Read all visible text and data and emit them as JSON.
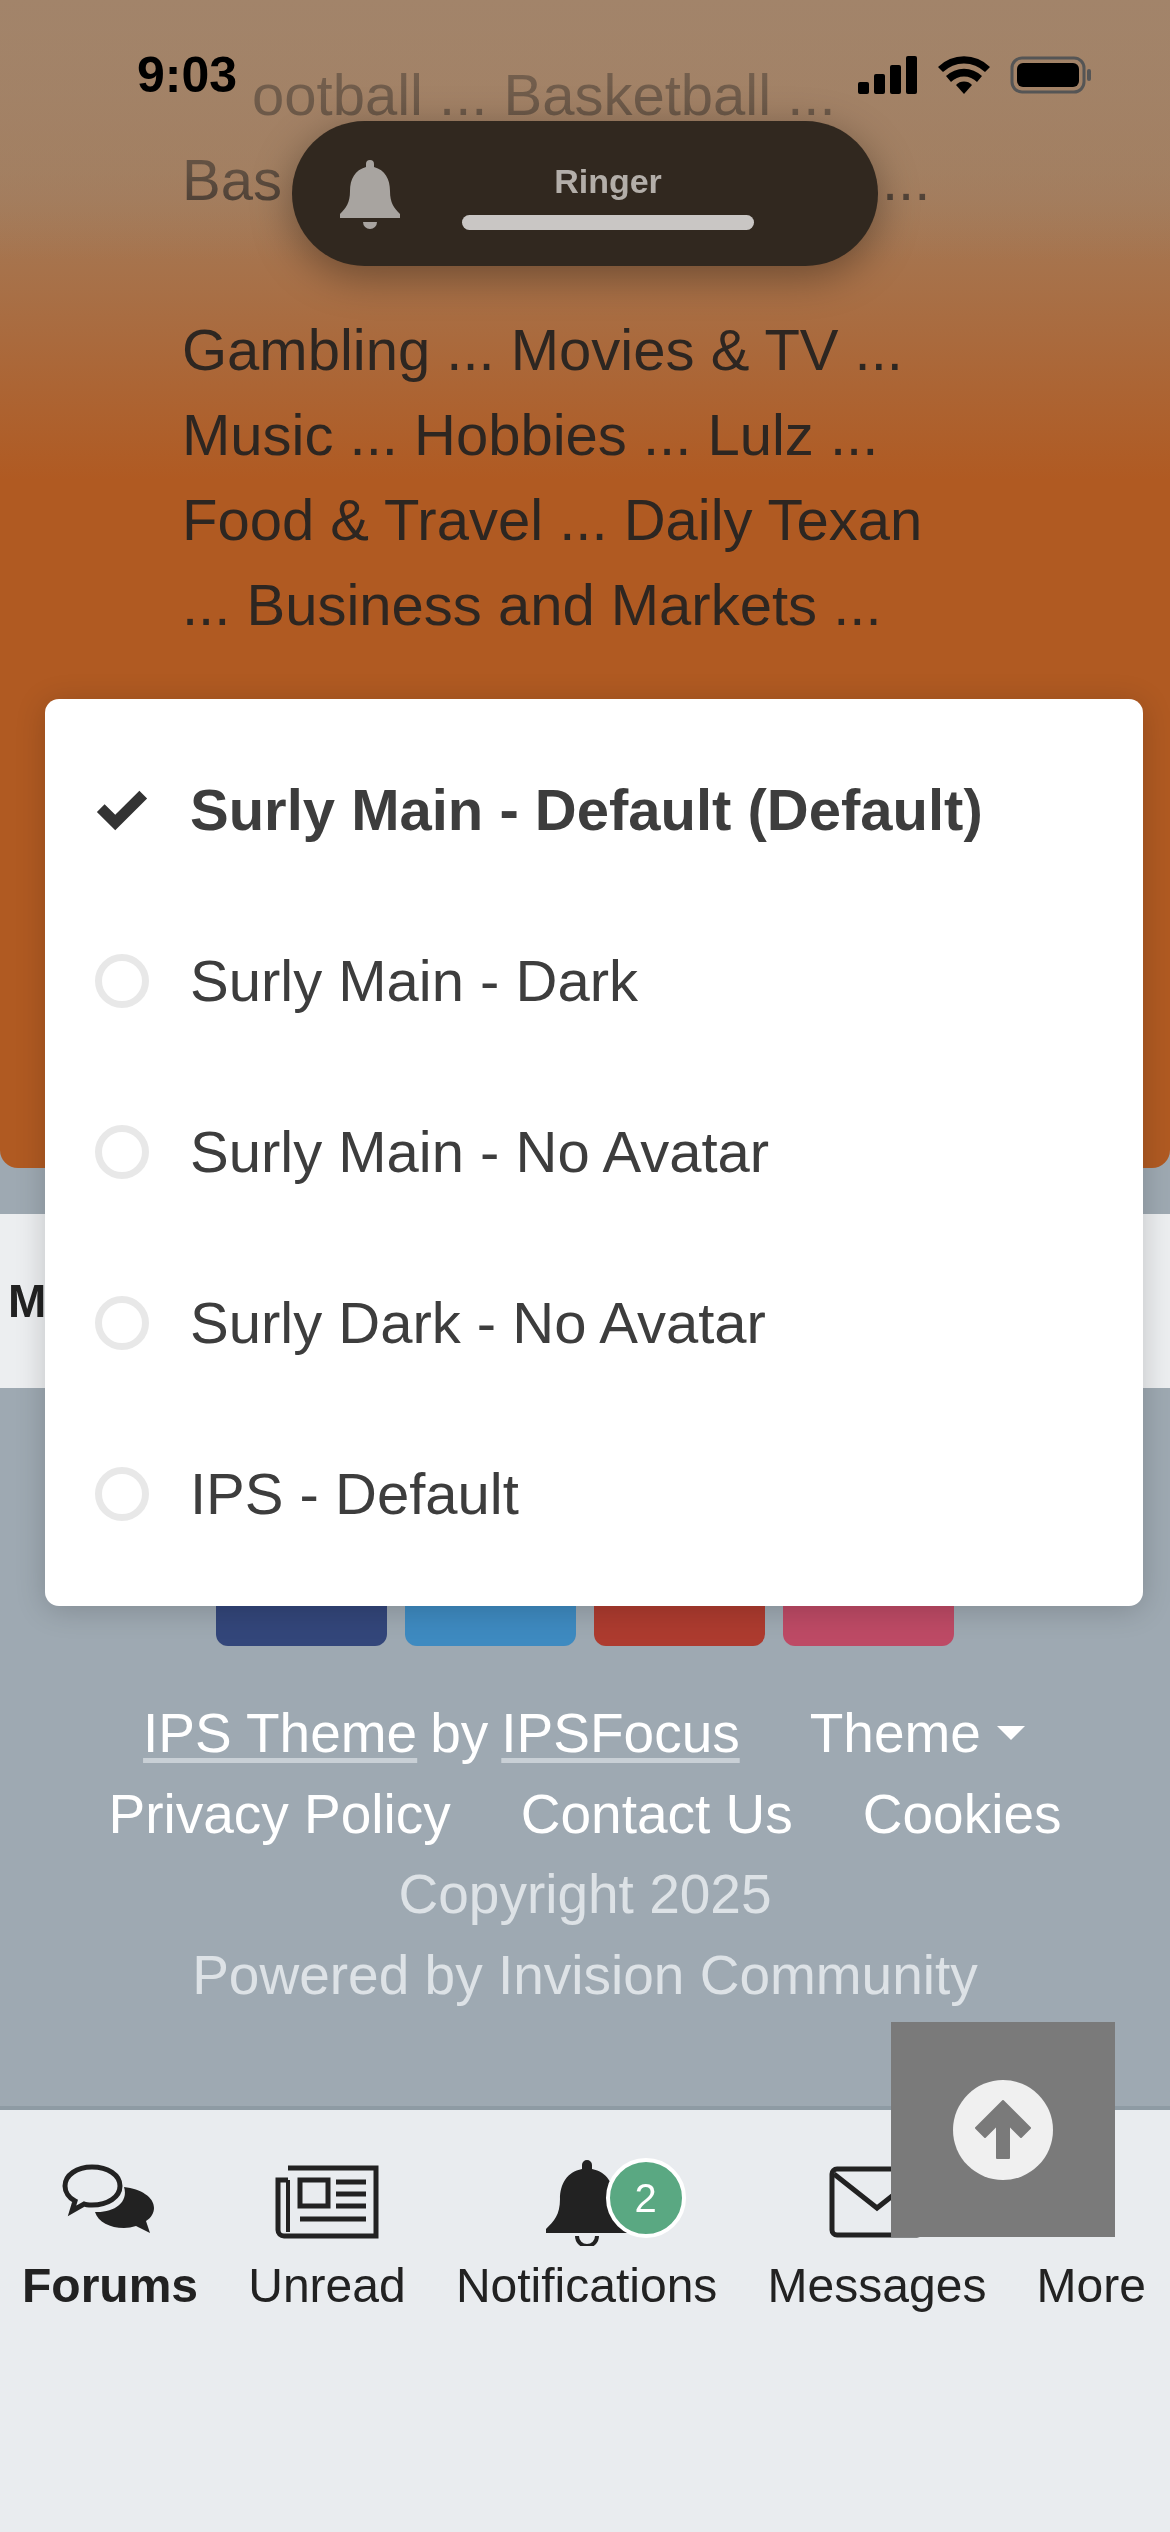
{
  "status_bar": {
    "time": "9:03"
  },
  "ringer": {
    "label": "Ringer",
    "level": 1
  },
  "top_links": [
    {
      "text": "ootball ... Basketball ..."
    },
    {
      "text": "Bas",
      "trailing": "..."
    }
  ],
  "header_links": [
    {
      "text": "Gambling ... Movies & TV ..."
    },
    {
      "text": "Music ... Hobbies ... Lulz ..."
    },
    {
      "text": "Food & Travel ... Daily Texan"
    },
    {
      "text": "... Business and Markets ..."
    }
  ],
  "tab_bar": {
    "label": "M"
  },
  "theme_menu": {
    "items": [
      {
        "label": "Surly Main - Default (Default)",
        "selected": true
      },
      {
        "label": "Surly Main - Dark",
        "selected": false
      },
      {
        "label": "Surly Main - No Avatar",
        "selected": false
      },
      {
        "label": "Surly Dark - No Avatar",
        "selected": false
      },
      {
        "label": "IPS - Default",
        "selected": false
      }
    ]
  },
  "social_buttons": [
    {
      "color": "#33467a"
    },
    {
      "color": "#3e8ac0"
    },
    {
      "color": "#ad3b2f"
    },
    {
      "color": "#bd4a65"
    }
  ],
  "footer": {
    "credit_link": "IPS Theme",
    "credit_by": "by",
    "author_link": "IPSFocus",
    "theme_button": "Theme",
    "links": [
      "Privacy Policy",
      "Contact Us",
      "Cookies"
    ],
    "copyright": "Copyright 2025",
    "powered_by": "Powered by Invision Community"
  },
  "bottom_nav": [
    {
      "kind": "forums",
      "label": "Forums",
      "selected": true
    },
    {
      "kind": "unread",
      "label": "Unread",
      "selected": false
    },
    {
      "kind": "notifications",
      "label": "Notifications",
      "selected": false,
      "badge": "2"
    },
    {
      "kind": "messages",
      "label": "Messages",
      "selected": false
    },
    {
      "kind": "more",
      "label": "More",
      "selected": false
    }
  ]
}
